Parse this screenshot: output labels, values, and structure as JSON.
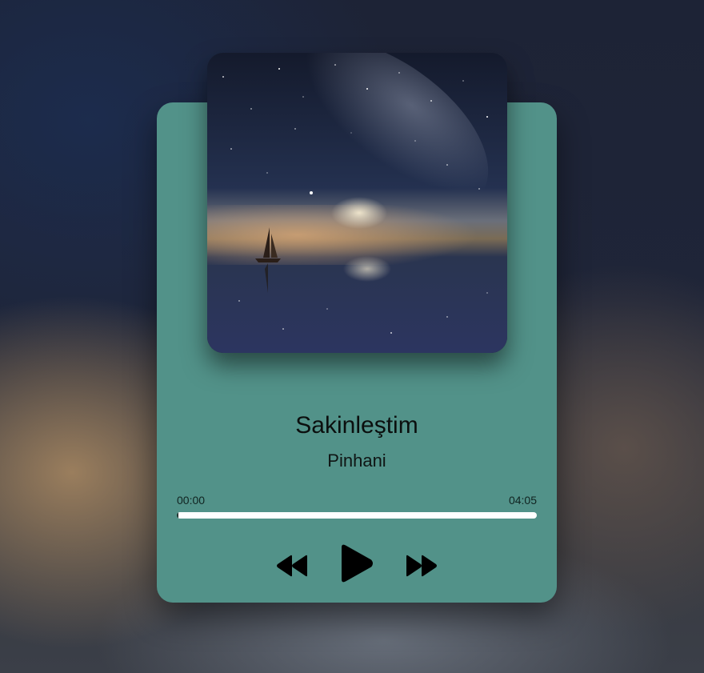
{
  "track": {
    "title": "Sakinleştim",
    "artist": "Pinhani"
  },
  "progress": {
    "current_time": "00:00",
    "duration": "04:05",
    "fraction": 0.0
  },
  "controls": {
    "prev_icon": "rewind-icon",
    "play_icon": "play-icon",
    "next_icon": "fast-forward-icon"
  },
  "colors": {
    "card": "#529289",
    "progress_track": "#ffffff",
    "progress_fill": "#1a2d2a",
    "icon": "#000000"
  },
  "cover": {
    "description_icon": "album-cover-image"
  }
}
